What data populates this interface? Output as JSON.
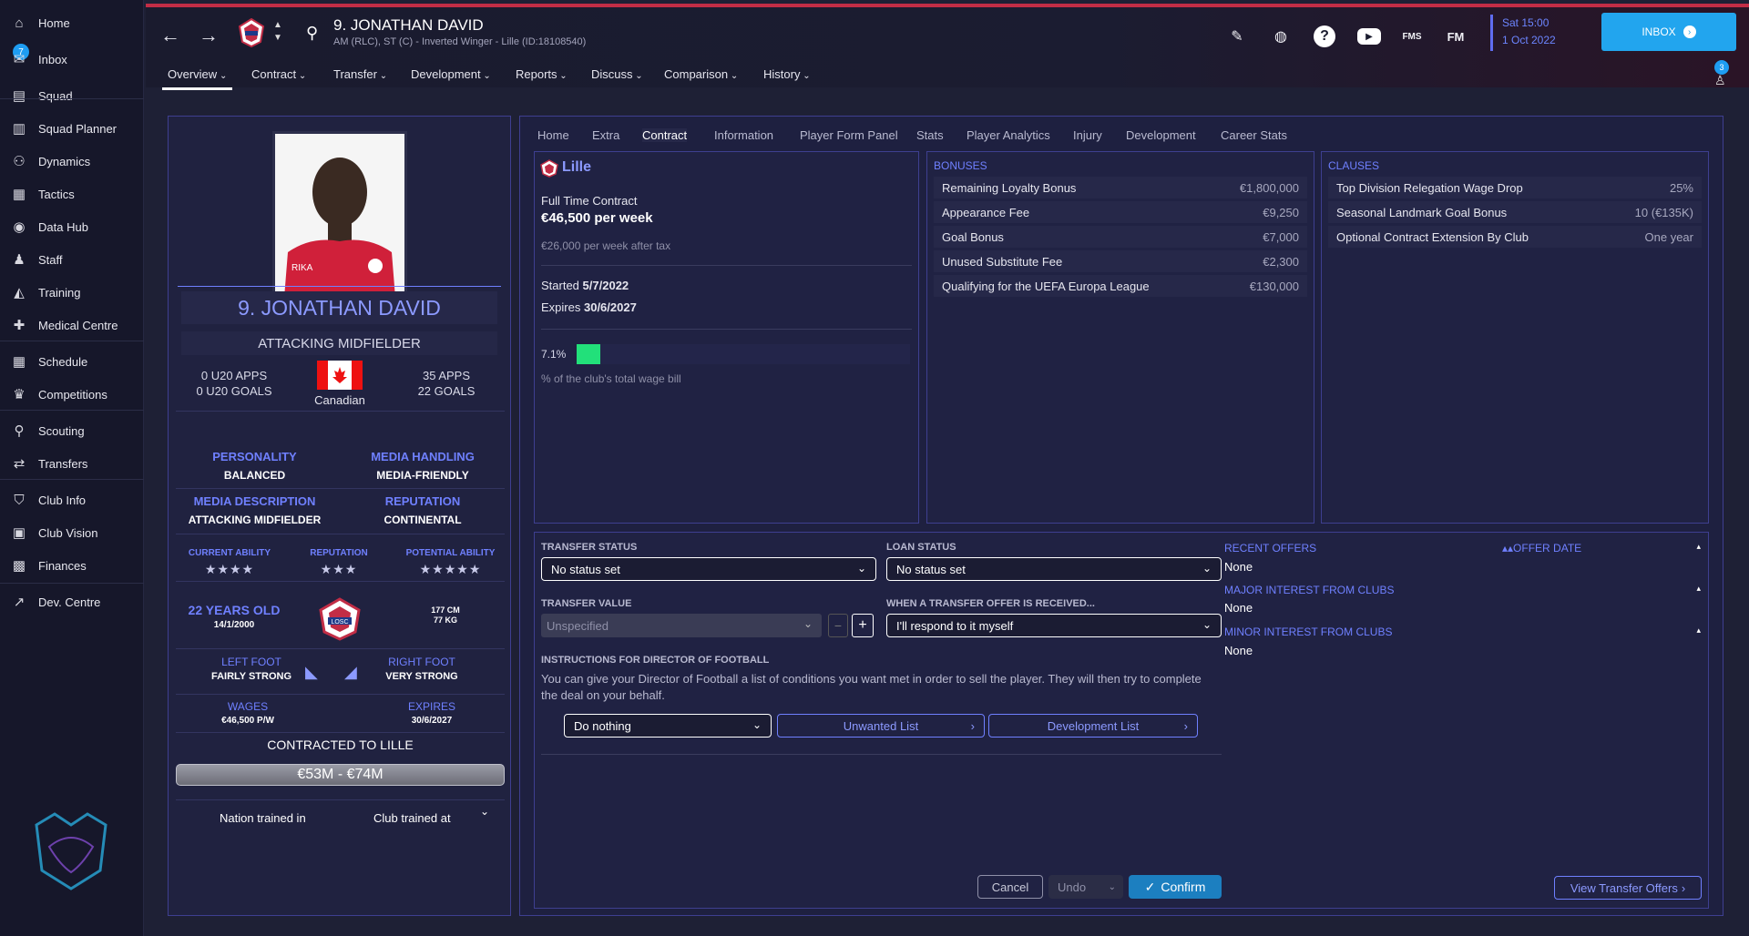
{
  "sidebar": {
    "inbox_badge": "7",
    "items": [
      {
        "label": "Home",
        "icon": "home-icon",
        "glyph": "⌂"
      },
      {
        "label": "Inbox",
        "icon": "inbox-icon",
        "glyph": "✉"
      },
      {
        "label": "Squad",
        "icon": "squad-icon",
        "glyph": "▤"
      },
      {
        "label": "Squad Planner",
        "icon": "squad-planner-icon",
        "glyph": "▥"
      },
      {
        "label": "Dynamics",
        "icon": "dynamics-icon",
        "glyph": "⚇"
      },
      {
        "label": "Tactics",
        "icon": "tactics-icon",
        "glyph": "▦"
      },
      {
        "label": "Data Hub",
        "icon": "data-hub-icon",
        "glyph": "◉"
      },
      {
        "label": "Staff",
        "icon": "staff-icon",
        "glyph": "♟"
      },
      {
        "label": "Training",
        "icon": "training-icon",
        "glyph": "◭"
      },
      {
        "label": "Medical Centre",
        "icon": "medical-icon",
        "glyph": "✚"
      },
      {
        "label": "Schedule",
        "icon": "schedule-icon",
        "glyph": "▦"
      },
      {
        "label": "Competitions",
        "icon": "trophy-icon",
        "glyph": "♛"
      },
      {
        "label": "Scouting",
        "icon": "scouting-icon",
        "glyph": "⚲"
      },
      {
        "label": "Transfers",
        "icon": "transfers-icon",
        "glyph": "⇄"
      },
      {
        "label": "Club Info",
        "icon": "club-info-icon",
        "glyph": "⛉"
      },
      {
        "label": "Club Vision",
        "icon": "club-vision-icon",
        "glyph": "▣"
      },
      {
        "label": "Finances",
        "icon": "finances-icon",
        "glyph": "▩"
      },
      {
        "label": "Dev. Centre",
        "icon": "dev-centre-icon",
        "glyph": "↗"
      }
    ]
  },
  "header": {
    "player_name": "9. JONATHAN DAVID",
    "player_sub": "AM (RLC), ST (C) - Inverted Winger - Lille (ID:18108540)",
    "date_line1": "Sat 15:00",
    "date_line2": "1 Oct 2022",
    "inbox_label": "INBOX",
    "fm_label": "FM",
    "fms_label": "FMS",
    "notif_count": "3"
  },
  "menu": [
    "Overview",
    "Contract",
    "Transfer",
    "Development",
    "Reports",
    "Discuss",
    "Comparison",
    "History"
  ],
  "tabs": [
    "Home",
    "Extra",
    "Contract",
    "Information",
    "Player Form Panel",
    "Stats",
    "Player Analytics",
    "Injury",
    "Development",
    "Career Stats"
  ],
  "profile": {
    "name": "9. JONATHAN DAVID",
    "position": "ATTACKING MIDFIELDER",
    "u20_apps": "0 U20 APPS",
    "u20_goals": "0 U20 GOALS",
    "nationality": "Canadian",
    "apps": "35 APPS",
    "goals": "22 GOALS",
    "personality_lbl": "PERSONALITY",
    "personality": "BALANCED",
    "media_handling_lbl": "MEDIA HANDLING",
    "media_handling": "MEDIA-FRIENDLY",
    "media_desc_lbl": "MEDIA DESCRIPTION",
    "media_desc": "ATTACKING MIDFIELDER",
    "reputation_lbl": "REPUTATION",
    "reputation": "CONTINENTAL",
    "current_ability_lbl": "CURRENT ABILITY",
    "current_ability_stars": "★★★★",
    "reputation_stars_lbl": "REPUTATION",
    "reputation_stars": "★★★",
    "potential_ability_lbl": "POTENTIAL ABILITY",
    "potential_ability_stars": "★★★★★",
    "age": "22 YEARS OLD",
    "dob": "14/1/2000",
    "height": "177 CM",
    "weight": "77 KG",
    "left_foot_lbl": "LEFT FOOT",
    "left_foot": "FAIRLY STRONG",
    "right_foot_lbl": "RIGHT FOOT",
    "right_foot": "VERY STRONG",
    "wages_lbl": "WAGES",
    "wages": "€46,500 P/W",
    "expires_lbl": "EXPIRES",
    "expires": "30/6/2027",
    "contracted": "CONTRACTED TO LILLE",
    "value_range": "€53M - €74M",
    "nation_trained": "Nation trained in",
    "club_trained": "Club trained at",
    "club_badge": "LOSC"
  },
  "contract": {
    "club": "Lille",
    "type": "Full Time Contract",
    "wage": "€46,500 per week",
    "after_tax": "€26,000 per week after tax",
    "started_lbl": "Started",
    "started": "5/7/2022",
    "expires_lbl": "Expires",
    "expires": "30/6/2027",
    "wage_pct": "7.1%",
    "wage_pct_value": 7.1,
    "wage_bill_lbl": "% of the club's total wage bill"
  },
  "bonuses": {
    "title": "BONUSES",
    "rows": [
      {
        "label": "Remaining Loyalty Bonus",
        "value": "€1,800,000"
      },
      {
        "label": "Appearance Fee",
        "value": "€9,250"
      },
      {
        "label": "Goal Bonus",
        "value": "€7,000"
      },
      {
        "label": "Unused Substitute Fee",
        "value": "€2,300"
      },
      {
        "label": "Qualifying for the UEFA Europa League",
        "value": "€130,000"
      }
    ]
  },
  "clauses": {
    "title": "CLAUSES",
    "rows": [
      {
        "label": "Top Division Relegation Wage Drop",
        "value": "25%"
      },
      {
        "label": "Seasonal Landmark Goal Bonus",
        "value": "10 (€135K)"
      },
      {
        "label": "Optional Contract Extension By Club",
        "value": "One year"
      }
    ]
  },
  "transfer": {
    "status_lbl": "TRANSFER STATUS",
    "status": "No status set",
    "loan_lbl": "LOAN STATUS",
    "loan": "No status set",
    "value_lbl": "TRANSFER VALUE",
    "value_placeholder": "Unspecified",
    "offer_lbl": "WHEN A TRANSFER OFFER IS RECEIVED...",
    "offer": "I'll respond to it myself",
    "dof_lbl": "INSTRUCTIONS FOR DIRECTOR OF FOOTBALL",
    "dof_text": "You can give your Director of Football a list of conditions you want met in order to sell the player. They will then try to complete the deal on your behalf.",
    "dof_action": "Do nothing",
    "unwanted": "Unwanted List",
    "development": "Development List"
  },
  "offers": {
    "recent_lbl": "RECENT OFFERS",
    "offer_date_lbl": "OFFER DATE",
    "recent": "None",
    "major_lbl": "MAJOR INTEREST FROM CLUBS",
    "major": "None",
    "minor_lbl": "MINOR INTEREST FROM CLUBS",
    "minor": "None"
  },
  "footer": {
    "cancel": "Cancel",
    "undo": "Undo",
    "confirm": "Confirm",
    "view_offers": "View Transfer Offers"
  },
  "colors": {
    "accent": "#6f80ff",
    "inbox": "#22a5ee",
    "confirm": "#1c7fc0",
    "wage_bar": "#22e07a"
  }
}
